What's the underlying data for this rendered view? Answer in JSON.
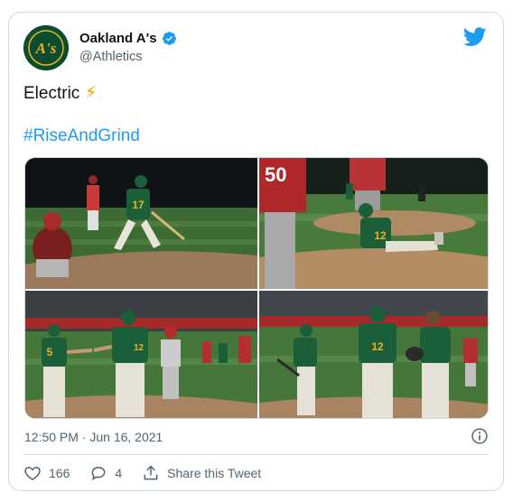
{
  "tweet": {
    "author": {
      "name": "Oakland A's",
      "handle": "@Athletics",
      "avatar_text": "A's",
      "verified": true
    },
    "text": "Electric",
    "emoji": "⚡",
    "hashtag": "#RiseAndGrind",
    "timestamp": "12:50 PM · Jun 16, 2021",
    "likes": "166",
    "replies": "4",
    "share_label": "Share this Tweet",
    "photos": [
      {
        "jersey": "17"
      },
      {
        "jersey": "12"
      },
      {
        "jersey": "5"
      },
      {
        "jersey": "12"
      }
    ]
  },
  "colors": {
    "twitter_blue": "#1d9bf0",
    "athletics_green": "#0b4d2e",
    "athletics_gold": "#efb21e",
    "secondary_text": "#536471"
  }
}
